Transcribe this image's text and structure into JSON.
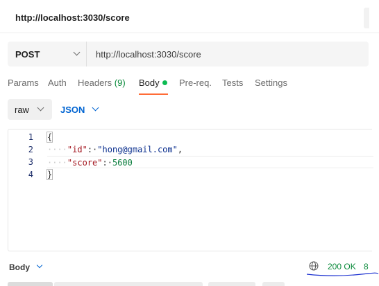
{
  "header": {
    "title": "http://localhost:3030/score"
  },
  "request": {
    "method": "POST",
    "url": "http://localhost:3030/score"
  },
  "tabs": [
    {
      "label": "Params"
    },
    {
      "label": "Auth"
    },
    {
      "label": "Headers",
      "count": "(9)"
    },
    {
      "label": "Body",
      "active": true
    },
    {
      "label": "Pre-req."
    },
    {
      "label": "Tests"
    },
    {
      "label": "Settings"
    }
  ],
  "body_mode": {
    "type": "raw",
    "format": "JSON"
  },
  "editor": {
    "line_numbers": [
      "1",
      "2",
      "3",
      "4"
    ],
    "open_brace": "{",
    "close_brace": "}",
    "fields": [
      {
        "key": "\"id\"",
        "value": "\"hong@gmail.com\"",
        "trailing": ","
      },
      {
        "key": "\"score\"",
        "value": "5600",
        "trailing": ""
      }
    ]
  },
  "response": {
    "label": "Body",
    "status": "200 OK",
    "time_partial": "8"
  },
  "colors": {
    "accent": "#ff6c37",
    "link_blue": "#0265d2",
    "success_green": "#0a8a3b",
    "body_dot": "#0cbb52"
  },
  "icons": [
    "chevron-down-icon",
    "globe-icon"
  ]
}
